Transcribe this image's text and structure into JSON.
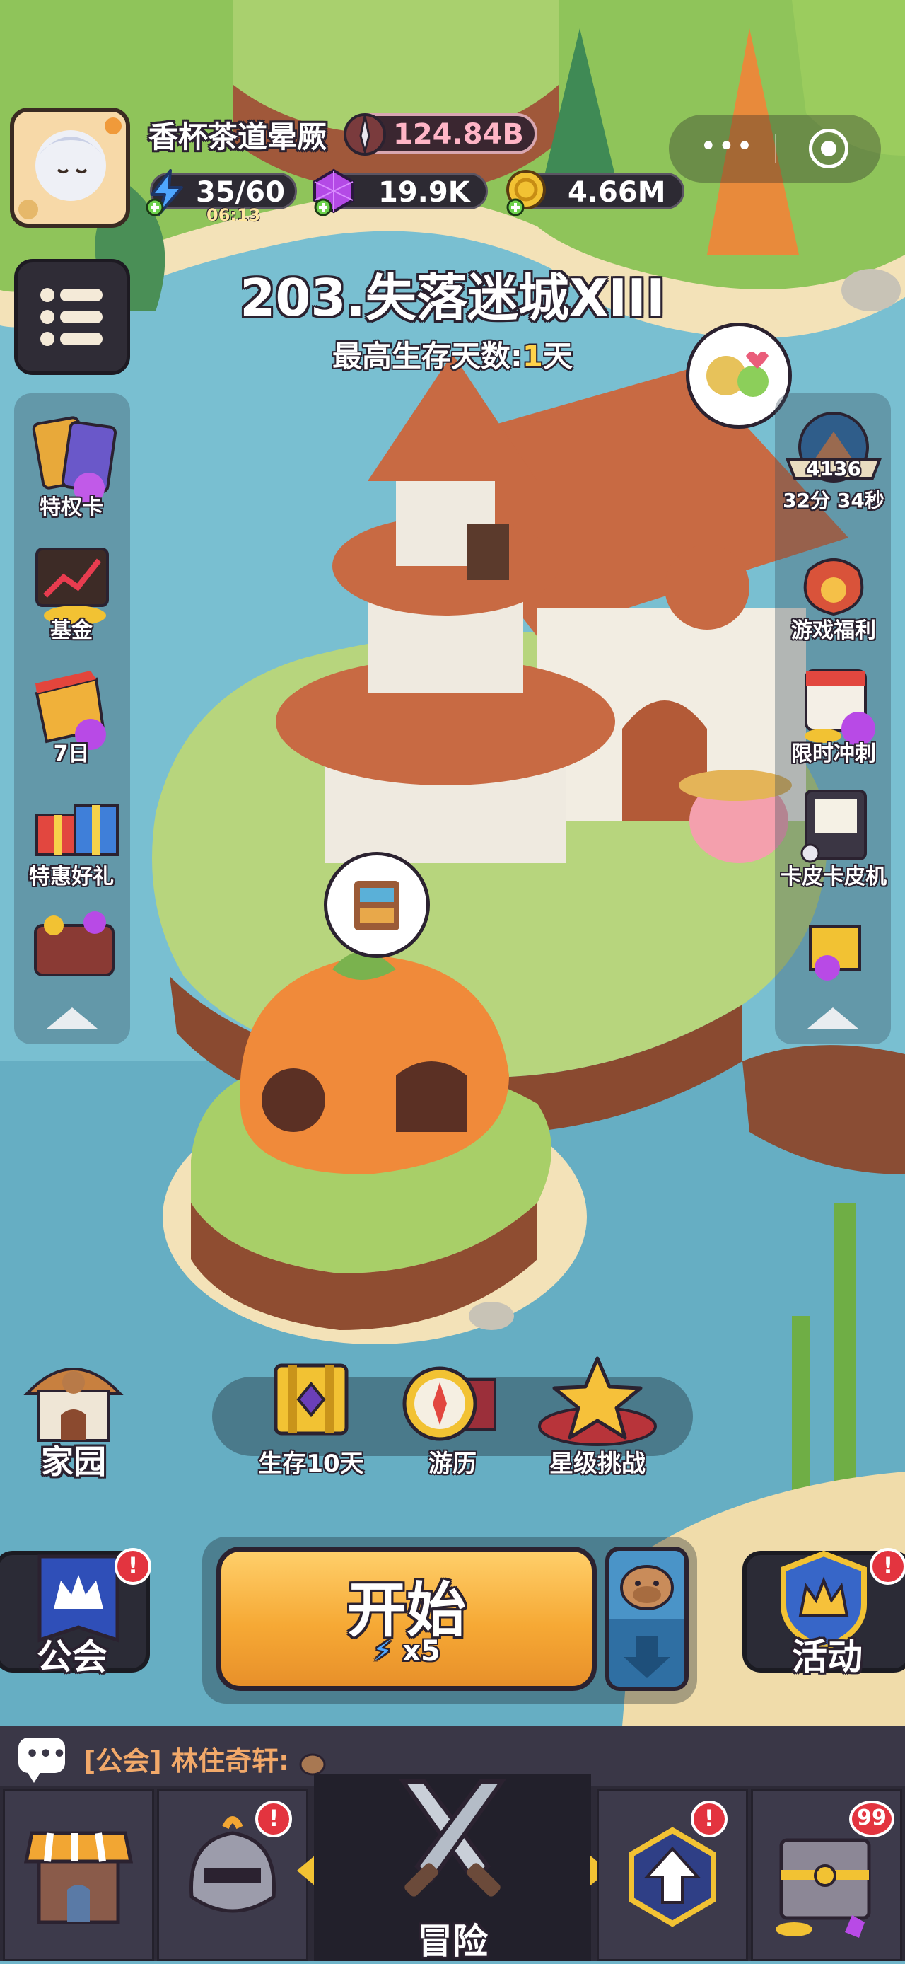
{
  "player": {
    "name": "香杯茶道晕厥",
    "power": "124.84B",
    "energy": "35/60",
    "energy_timer": "06:13",
    "gems": "19.9K",
    "coins": "4.66M"
  },
  "stage": {
    "title": "203.失落迷城XIII",
    "survival_prefix": "最高生存天数:",
    "survival_days": "1",
    "survival_suffix": "天"
  },
  "left_menu": [
    {
      "label": "特权卡",
      "icon": "privilege-card-icon"
    },
    {
      "label": "基金",
      "icon": "fund-chart-icon"
    },
    {
      "label": "7日",
      "icon": "seven-day-icon"
    },
    {
      "label": "特惠好礼",
      "icon": "gift-box-icon"
    },
    {
      "label": "",
      "icon": "treasure-chest-icon"
    }
  ],
  "right_menu": {
    "event_count": "4136",
    "event_timer": "32分 34秒",
    "items": [
      {
        "label": "游戏福利",
        "icon": "lucky-bag-icon"
      },
      {
        "label": "限时冲刺",
        "icon": "calendar-sprint-icon"
      },
      {
        "label": "卡皮卡皮机",
        "icon": "arcade-machine-icon"
      },
      {
        "label": "",
        "icon": "gift-pile-icon"
      }
    ]
  },
  "activities": [
    {
      "label": "生存10天",
      "icon": "survival-chest-icon"
    },
    {
      "label": "游历",
      "icon": "compass-map-icon"
    },
    {
      "label": "星级挑战",
      "icon": "star-challenge-icon"
    }
  ],
  "home": {
    "label": "家园"
  },
  "guild": {
    "label": "公会",
    "badge": "!"
  },
  "event": {
    "label": "活动",
    "badge": "!"
  },
  "start": {
    "label": "开始",
    "cost": "x5"
  },
  "chat": {
    "channel": "[公会]",
    "sender": "林住奇轩:"
  },
  "nav": {
    "center_label": "冒险",
    "tabs": [
      {
        "name": "shop",
        "icon": "shop-stall-icon",
        "badge": ""
      },
      {
        "name": "equipment",
        "icon": "knight-helmet-icon",
        "badge": "!"
      },
      {
        "name": "adventure",
        "icon": "crossed-swords-icon",
        "badge": ""
      },
      {
        "name": "upgrade",
        "icon": "upgrade-arrow-icon",
        "badge": "!"
      },
      {
        "name": "chest",
        "icon": "treasure-chest-icon",
        "badge": "99"
      }
    ]
  },
  "colors": {
    "start_button": "#f6a935",
    "highlight_number": "#ffd34a",
    "chat_channel": "#f2a96a",
    "badge": "#e3343f",
    "power_text": "#ffb5c6"
  }
}
